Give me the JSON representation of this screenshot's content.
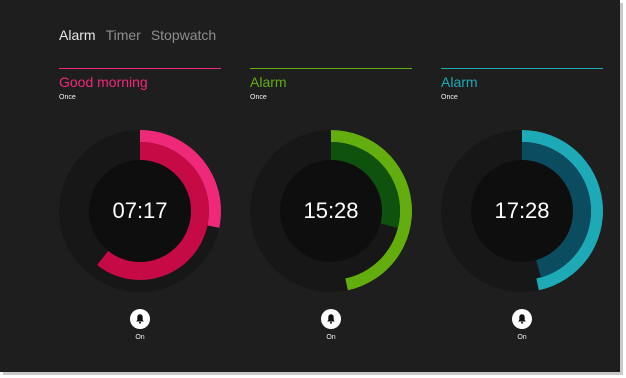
{
  "tabs": [
    {
      "label": "Alarm",
      "active": true
    },
    {
      "label": "Timer",
      "active": false
    },
    {
      "label": "Stopwatch",
      "active": false
    }
  ],
  "alarms": [
    {
      "name": "Good morning",
      "repeat": "Once",
      "time": "07:17",
      "hours": 7,
      "minutes": 17,
      "status": "On",
      "icon": "bell-icon",
      "colors": {
        "accent": "#f0287a",
        "hour_ring": "#c50a45",
        "outer_track": "#171717",
        "inner_face": "#0e0e0e"
      }
    },
    {
      "name": "Alarm",
      "repeat": "Once",
      "time": "15:28",
      "hours": 15,
      "minutes": 28,
      "status": "On",
      "icon": "bell-icon",
      "colors": {
        "accent": "#64ad0f",
        "hour_ring": "#0f520e",
        "outer_track": "#171717",
        "inner_face": "#0e0e0e"
      }
    },
    {
      "name": "Alarm",
      "repeat": "Once",
      "time": "17:28",
      "hours": 17,
      "minutes": 28,
      "status": "On",
      "icon": "bell-icon",
      "colors": {
        "accent": "#1ea9b7",
        "hour_ring": "#0c4c60",
        "outer_track": "#171717",
        "inner_face": "#0e0e0e"
      }
    }
  ]
}
